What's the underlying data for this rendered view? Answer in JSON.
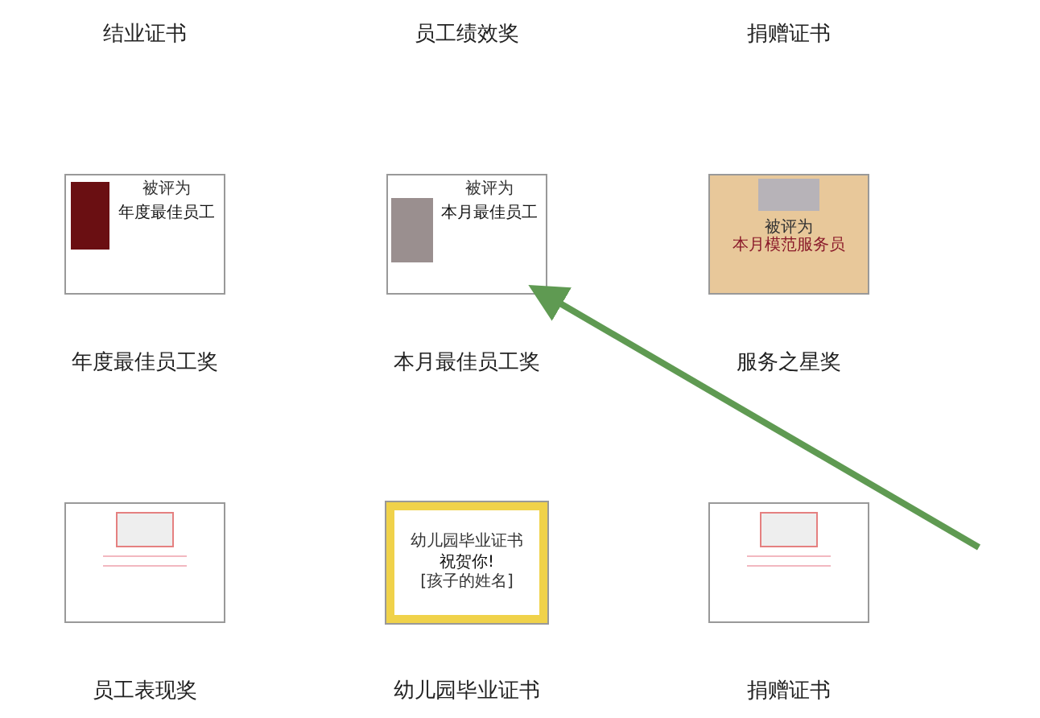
{
  "templates": [
    {
      "label": "结业证书"
    },
    {
      "label": "员工绩效奖"
    },
    {
      "label": "捐赠证书"
    },
    {
      "label": "年度最佳员工奖",
      "thumbnail": {
        "kind": "trophy",
        "lines": [
          "被评为",
          "年度最佳员工"
        ]
      }
    },
    {
      "label": "本月最佳员工奖",
      "thumbnail": {
        "kind": "ribbon",
        "lines": [
          "被评为",
          "本月最佳员工"
        ]
      }
    },
    {
      "label": "服务之星奖",
      "thumbnail": {
        "kind": "bell",
        "lines": [
          "被评为",
          "本月模范服务员"
        ]
      }
    },
    {
      "label": "员工表现奖",
      "thumbnail": {
        "kind": "rose"
      }
    },
    {
      "label": "幼儿园毕业证书",
      "thumbnail": {
        "kind": "kindergarten",
        "lines": [
          "幼儿园毕业证书",
          "祝贺你!",
          "[孩子的姓名]"
        ]
      }
    },
    {
      "label": "捐赠证书",
      "thumbnail": {
        "kind": "rose"
      }
    }
  ]
}
